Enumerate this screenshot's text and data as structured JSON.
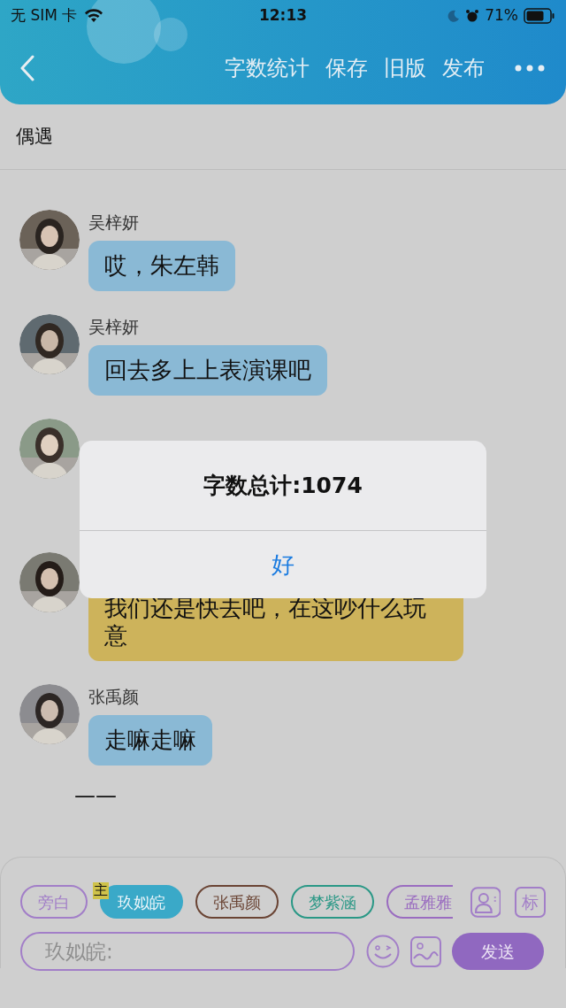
{
  "status_bar": {
    "carrier": "无 SIM 卡",
    "time": "12:13",
    "battery": "71%"
  },
  "header": {
    "actions": [
      "字数统计",
      "保存",
      "旧版",
      "发布"
    ]
  },
  "title": "偶遇",
  "messages": [
    {
      "name": "吴梓妍",
      "text": "哎，朱左韩",
      "color": "#8ab9d5"
    },
    {
      "name": "吴梓妍",
      "text": "回去多上上表演课吧",
      "color": "#8ab9d5"
    },
    {
      "kind": "covered"
    },
    {
      "text": "我们还是快去吧，在这吵什么玩意",
      "color": "#cdb35b"
    },
    {
      "name": "张禹颜",
      "text": "走嘛走嘛",
      "color": "#8ab9d5"
    }
  ],
  "trailing_text": "——",
  "dialog": {
    "message": "字数总计:1074",
    "button": "好"
  },
  "roles": [
    {
      "label": "旁白",
      "color": "#a27ec8",
      "selected": false
    },
    {
      "label": "玖姒皖",
      "color": "#3aa9c8",
      "selected": true,
      "badge": "主"
    },
    {
      "label": "张禹颜",
      "color": "#6a4434",
      "selected": false
    },
    {
      "label": "梦紫涵",
      "color": "#2a9886",
      "selected": false
    },
    {
      "label": "孟雅雅",
      "color": "#9a6cc0",
      "selected": false
    }
  ],
  "tag_button": "标",
  "input": {
    "placeholder": "玖姒皖:"
  },
  "send_button": "发送"
}
